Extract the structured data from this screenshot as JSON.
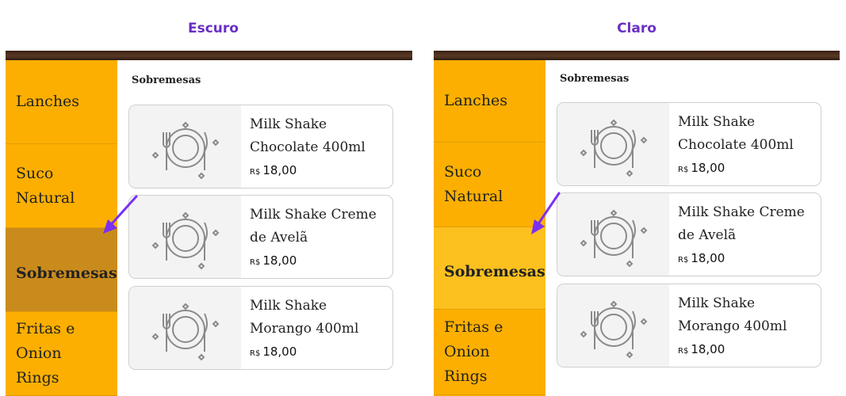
{
  "panels": [
    {
      "label": "Escuro",
      "active_bg": "#c98b1c",
      "section_title": "Sobremesas",
      "categories": [
        {
          "label": "Lanches"
        },
        {
          "label": "Suco Natural"
        },
        {
          "label": "Sobremesas",
          "active": true
        },
        {
          "label": "Fritas e Onion Rings"
        }
      ],
      "products": [
        {
          "name": "Milk Shake Chocolate 400ml",
          "currency": "R$",
          "price": "18,00"
        },
        {
          "name": "Milk Shake Creme de Avelã",
          "currency": "R$",
          "price": "18,00"
        },
        {
          "name": "Milk Shake Morango 400ml",
          "currency": "R$",
          "price": "18,00"
        }
      ]
    },
    {
      "label": "Claro",
      "active_bg": "#fcc01f",
      "section_title": "Sobremesas",
      "categories": [
        {
          "label": "Lanches"
        },
        {
          "label": "Suco Natural"
        },
        {
          "label": "Sobremesas",
          "active": true
        },
        {
          "label": "Fritas e Onion Rings"
        }
      ],
      "products": [
        {
          "name": "Milk Shake Chocolate 400ml",
          "currency": "R$",
          "price": "18,00"
        },
        {
          "name": "Milk Shake Creme de Avelã",
          "currency": "R$",
          "price": "18,00"
        },
        {
          "name": "Milk Shake Morango 400ml",
          "currency": "R$",
          "price": "18,00"
        }
      ]
    }
  ],
  "colors": {
    "accent": "#6a2fc4",
    "sidebar": "#fcaf00",
    "arrow": "#7b2ff2"
  },
  "icons": {
    "product_placeholder": "plate-fork-knife-icon",
    "annotation": "arrow-icon"
  }
}
